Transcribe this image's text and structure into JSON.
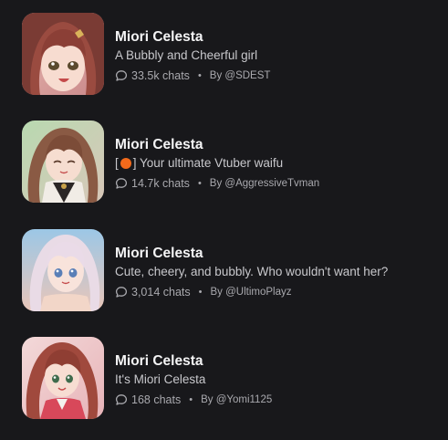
{
  "characters": [
    {
      "name": "Miori Celesta",
      "tagline": "A Bubbly and Cheerful girl",
      "tagline_prefix": "",
      "tagline_suffix": "",
      "chats": "33.5k chats",
      "separator": "•",
      "author": "By @SDEST"
    },
    {
      "name": "Miori Celesta",
      "tagline": "",
      "tagline_prefix": "[",
      "tagline_suffix": "] Your ultimate Vtuber waifu",
      "chats": "14.7k chats",
      "separator": "•",
      "author": "By @AggressiveTvman"
    },
    {
      "name": "Miori Celesta",
      "tagline": "Cute, cheery, and bubbly. Who wouldn't want her?",
      "tagline_prefix": "",
      "tagline_suffix": "",
      "chats": "3,014 chats",
      "separator": "•",
      "author": "By @UltimoPlayz"
    },
    {
      "name": "Miori Celesta",
      "tagline": "It's Miori Celesta",
      "tagline_prefix": "",
      "tagline_suffix": "",
      "chats": "168 chats",
      "separator": "•",
      "author": "By @Yomi1125"
    }
  ],
  "icons": {
    "chat": "chat-bubble-icon",
    "status": "orange-circle-emoji"
  },
  "colors": {
    "background": "#18181b",
    "name": "#f4f4f5",
    "tagline": "#c8c8cc",
    "meta": "#a9a9ae",
    "emoji": "#f26a1b"
  }
}
